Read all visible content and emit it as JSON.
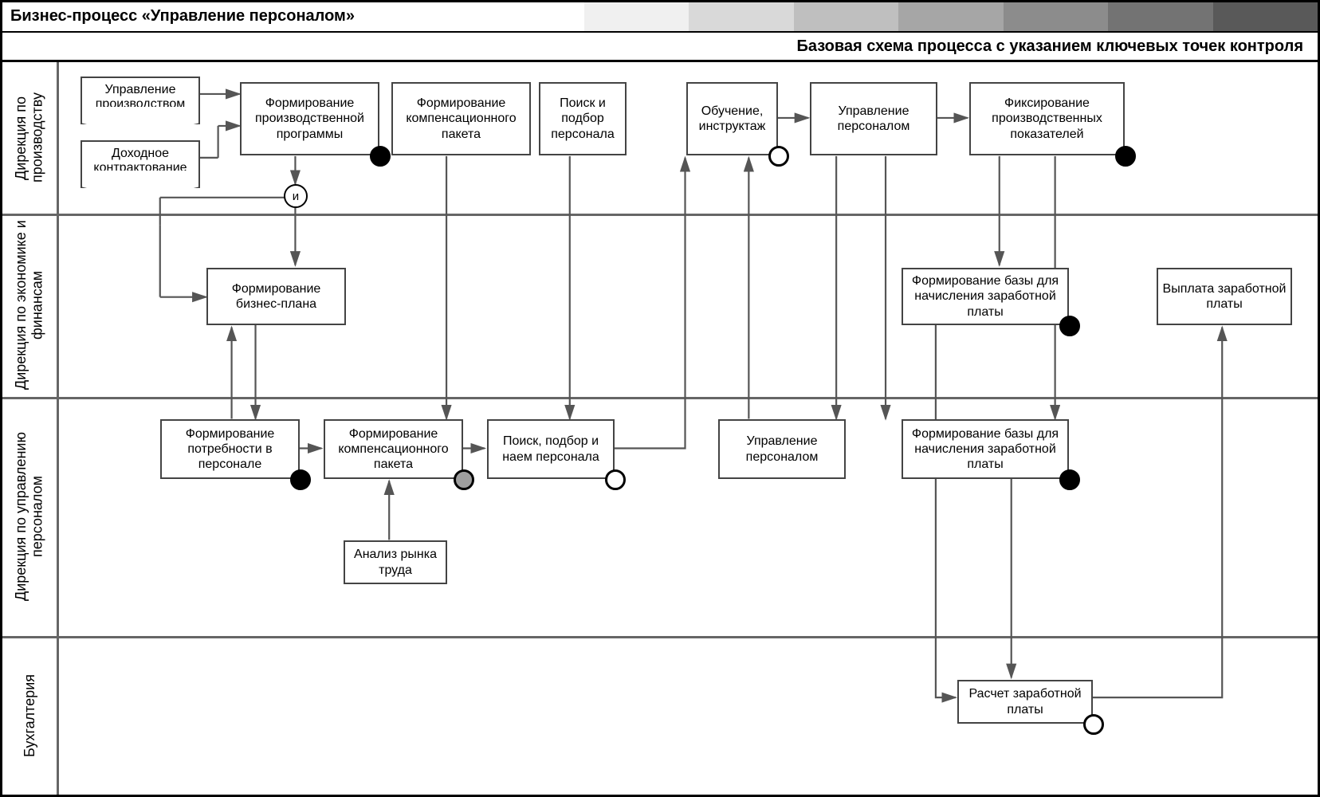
{
  "header": {
    "title": "Бизнес-процесс «Управление персоналом»"
  },
  "subheader": "Базовая схема процесса с указанием ключевых точек контроля",
  "lanes": {
    "l1": "Дирекция\nпо производству",
    "l2": "Дирекция\nпо экономике\nи финансам",
    "l3": "Дирекция\nпо управлению персоналом",
    "l4": "Бухгалтерия"
  },
  "offpage": {
    "op1": "Управление\nпроизводством",
    "op2": "Доходное\nконтрактование"
  },
  "gate": {
    "and": "и"
  },
  "nodes": {
    "n1": "Формирование\nпроизводственной\nпрограммы",
    "n2": "Формирование\nкомпенсационного\nпакета",
    "n3": "Поиск\nи подбор\nперсонала",
    "n4": "Обучение,\nинструктаж",
    "n5": "Управление\nперсоналом",
    "n6": "Фиксирование\nпроизводственных\nпоказателей",
    "n7": "Формирование\nбизнес-плана",
    "n8": "Формирование базы\nдля начисления\nзаработной платы",
    "n9": "Выплата\nзаработной платы",
    "n10": "Формирование\nпотребности\nв персонале",
    "n11": "Формирование\nкомпенсационного\nпакета",
    "n12": "Поиск, подбор\nи наем\nперсонала",
    "n13": "Управление\nперсоналом",
    "n14": "Формирование базы\nдля начисления\nзаработной платы",
    "n15": "Анализ\nрынка труда",
    "n16": "Расчет\nзаработной платы"
  },
  "swatches": [
    "#f0f0f0",
    "#d9d9d9",
    "#bfbfbf",
    "#a6a6a6",
    "#8c8c8c",
    "#737373",
    "#595959"
  ]
}
